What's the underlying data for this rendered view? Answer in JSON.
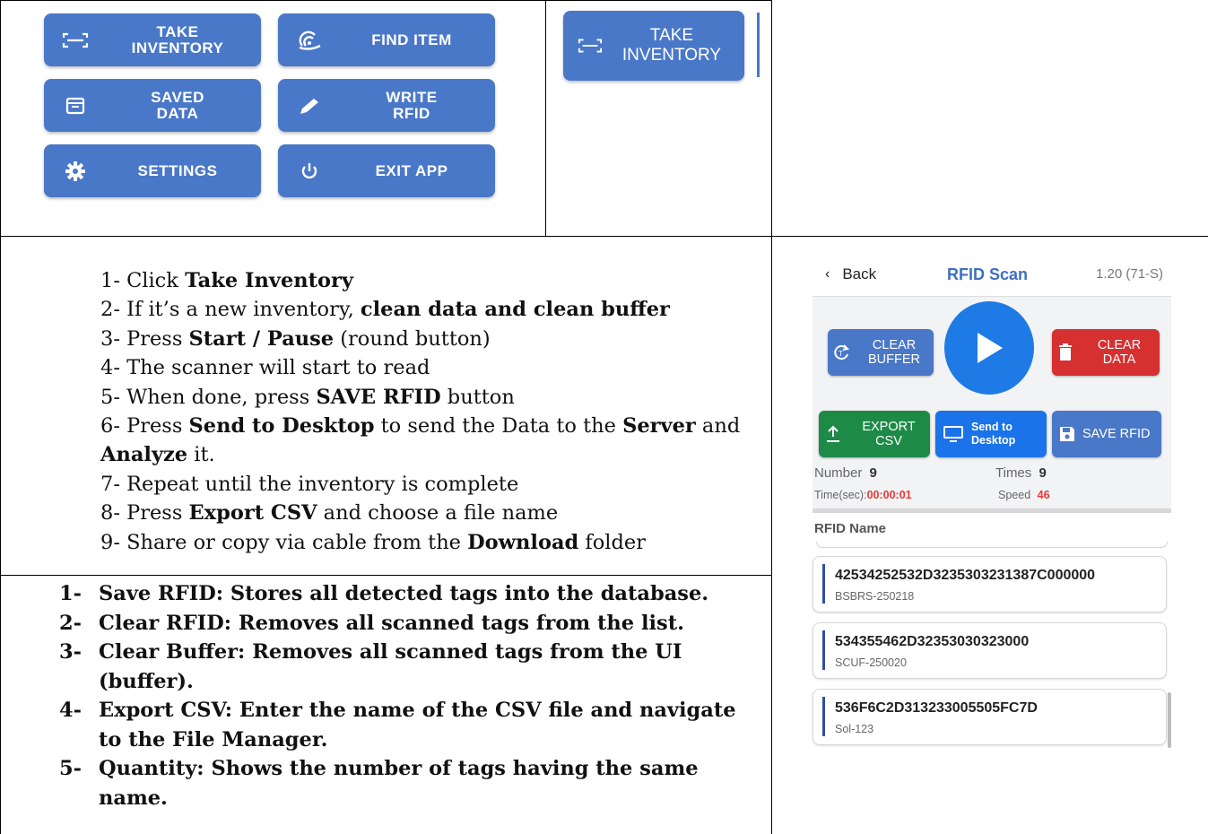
{
  "menu_buttons": {
    "take_inventory": "TAKE\nINVENTORY",
    "find_item": "FIND ITEM",
    "saved_data": "SAVED\nDATA",
    "write_rfid": "WRITE\nRFID",
    "settings": "SETTINGS",
    "exit_app": "EXIT APP"
  },
  "zoom_button": {
    "label": "TAKE\nINVENTORY"
  },
  "steps": [
    [
      {
        "t": "1- Click "
      },
      {
        "t": "Take Inventory",
        "b": true
      }
    ],
    [
      {
        "t": "2- If it’s a new inventory, "
      },
      {
        "t": "clean data and clean buffer",
        "b": true
      }
    ],
    [
      {
        "t": "3- Press "
      },
      {
        "t": "Start / Pause",
        "b": true
      },
      {
        "t": " (round button)"
      }
    ],
    [
      {
        "t": "4- The scanner will start to read"
      }
    ],
    [
      {
        "t": "5- When done, press "
      },
      {
        "t": "SAVE RFID",
        "b": true
      },
      {
        "t": " button"
      }
    ],
    [
      {
        "t": "6- Press "
      },
      {
        "t": "Send to Desktop",
        "b": true
      },
      {
        "t": " to send the Data to the "
      },
      {
        "t": "Server",
        "b": true
      },
      {
        "t": " and"
      }
    ],
    [
      {
        "t": "Analyze",
        "b": true
      },
      {
        "t": " it."
      }
    ],
    [
      {
        "t": "7- Repeat until the inventory is complete"
      }
    ],
    [
      {
        "t": "8- Press "
      },
      {
        "t": "Export CSV",
        "b": true
      },
      {
        "t": " and choose a file name"
      }
    ],
    [
      {
        "t": "9- Share or copy via cable from the "
      },
      {
        "t": "Download",
        "b": true
      },
      {
        "t": " folder"
      }
    ]
  ],
  "definitions": [
    {
      "num": "1-",
      "text": "Save RFID: Stores all detected tags into the database."
    },
    {
      "num": "2-",
      "text": "Clear RFID: Removes all scanned tags from the list."
    },
    {
      "num": "3-",
      "text": "Clear Buffer: Removes all scanned tags from the UI (buffer)."
    },
    {
      "num": "4-",
      "text": "Export CSV: Enter the name of the CSV file and navigate to the File Manager."
    },
    {
      "num": "5-",
      "text": "Quantity: Shows the number of tags having the same name."
    }
  ],
  "phone": {
    "back_label": "Back",
    "title": "RFID Scan",
    "version": "1.20 (71-S)",
    "clear_buffer": "CLEAR\nBUFFER",
    "clear_data": "CLEAR\nDATA",
    "export_csv": "EXPORT\nCSV",
    "send_to_desktop": "Send to\nDesktop",
    "save_rfid": "SAVE RFID",
    "number_label": "Number",
    "number_value": "9",
    "times_label": "Times",
    "times_value": "9",
    "time_label": "Time(sec):",
    "time_value": "00:00:01",
    "speed_label": "Speed",
    "speed_value": "46",
    "list_header": "RFID Name",
    "tags": [
      {
        "id": "42534252532D3235303231387C000000",
        "name": "BSBRS-250218"
      },
      {
        "id": "534355462D32353030323000",
        "name": "SCUF-250020"
      },
      {
        "id": "536F6C2D313233005505FC7D",
        "name": "Sol-123"
      }
    ],
    "colors": {
      "blue": "#4a78c8",
      "play": "#1e7be6",
      "red": "#d63031",
      "green": "#1e8a47",
      "send": "#1a73e8",
      "alert": "#e53935"
    }
  }
}
